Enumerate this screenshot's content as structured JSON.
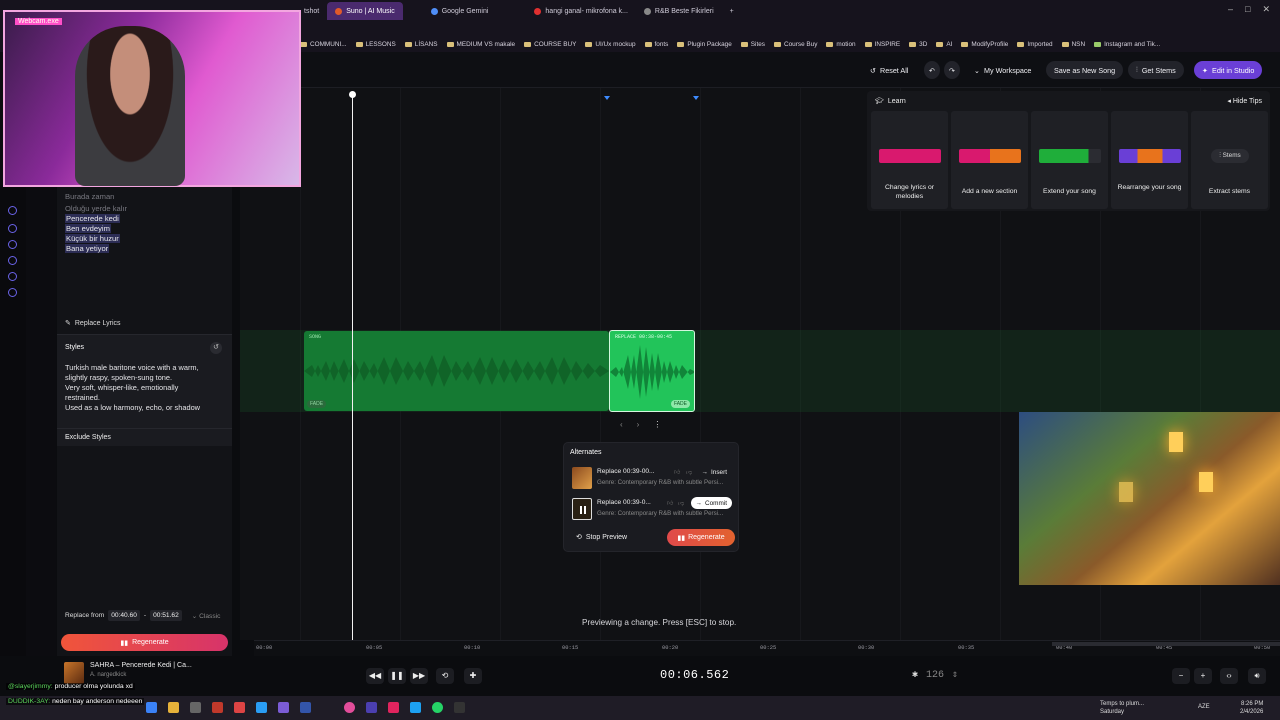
{
  "browser": {
    "tabs": [
      {
        "label": "Webcam.exe",
        "color": "#ff4fc8"
      },
      {
        "label": "tshot",
        "color": "#888888"
      },
      {
        "label": "Suno | AI Music",
        "color": "#e05a2a",
        "active": true
      },
      {
        "label": "Google Gemini",
        "color": "#4f8ef7"
      },
      {
        "label": "hangi ganal- mikrofona k...",
        "color": "#e03030"
      },
      {
        "label": "R&B Beste Fikirleri",
        "color": "#888888"
      }
    ],
    "bookmarks": [
      "COMMUNI...",
      "LESSONS",
      "LİSANS",
      "MEDIUM VS makale",
      "COURSE BUY",
      "UI/Ux mockup",
      "fonts",
      "Plugin Package",
      "Sites",
      "Course Buy",
      "motion",
      "INSPIRE",
      "3D",
      "AI",
      "ModifyProfile",
      "Imported",
      "NSN",
      "Instagram and Tik..."
    ]
  },
  "header": {
    "reset_all": "Reset All",
    "workspace": "My Workspace",
    "save_new": "Save as New Song",
    "get_stems": "Get Stems",
    "edit_studio": "Edit in Studio"
  },
  "webcam": {
    "title": "Webcam.exe"
  },
  "lyrics": [
    {
      "text": "Burada zaman",
      "style": "dim"
    },
    {
      "text": "Olduğu yerde kalır",
      "style": "dim"
    },
    {
      "text": "Pencerede kedi",
      "style": "hl"
    },
    {
      "text": "Ben evdeyim",
      "style": "hl"
    },
    {
      "text": "Küçük bir huzur",
      "style": "hl"
    },
    {
      "text": "Bana yetiyor",
      "style": "hl"
    }
  ],
  "left": {
    "replace_lyrics": "Replace Lyrics",
    "styles_title": "Styles",
    "styles_text": "Turkish male baritone voice with a warm, slightly raspy, spoken-sung tone.\nVery soft, whisper-like, emotionally restrained.\nUsed as a low harmony, echo, or shadow",
    "exclude_styles": "Exclude Styles",
    "replace_from": "Replace from",
    "from_time": "00:40.60",
    "to_time": "00:51.62",
    "classic": "Classic",
    "regenerate": "Regenerate"
  },
  "clips": {
    "song_label": "SONG",
    "replace_label": "REPLACE 00:38-00:45",
    "fade_label": "FADE",
    "fade_label2": "FADE"
  },
  "learn": {
    "title": "Learn",
    "hide_tips": "Hide Tips",
    "cards": [
      {
        "label": "Change lyrics or melodies"
      },
      {
        "label": "Add a new section"
      },
      {
        "label": "Extend your song"
      },
      {
        "label": "Rearrange your song"
      },
      {
        "label": "Extract stems",
        "chip": "Stems"
      }
    ]
  },
  "alternates": {
    "title": "Alternates",
    "items": [
      {
        "name": "Replace 00:39-00...",
        "genre": "Genre: Contemporary R&B with subtle Persi...",
        "action": "Insert"
      },
      {
        "name": "Replace 00:39-0...",
        "genre": "Genre: Contemporary R&B with subtle Persi...",
        "action": "Commit"
      }
    ],
    "stop_preview": "Stop Preview",
    "regenerate": "Regenerate"
  },
  "preview_message": "Previewing a change. Press [ESC] to stop.",
  "ruler": [
    "00:00",
    "00:05",
    "00:10",
    "00:15",
    "00:20",
    "00:25",
    "00:30",
    "00:35",
    "00:40",
    "00:45",
    "00:50"
  ],
  "transport": {
    "timecode": "00:06.562",
    "bpm": "126"
  },
  "now_playing": {
    "title": "SAHRA – Pencerede Kedi | Ca...",
    "artist": "A. nargedkick"
  },
  "chat": [
    {
      "user": "@slayerjimmy:",
      "text": "producer olma yolunda xd"
    },
    {
      "user": "DUDDIK-3AY:",
      "text": "neden bay anderson nedeeen"
    }
  ],
  "taskbar": {
    "weather": "Temps to plum...",
    "weather_sub": "Saturday",
    "lang": "AZE",
    "time": "8:26 PM",
    "date": "2/4/2026"
  }
}
